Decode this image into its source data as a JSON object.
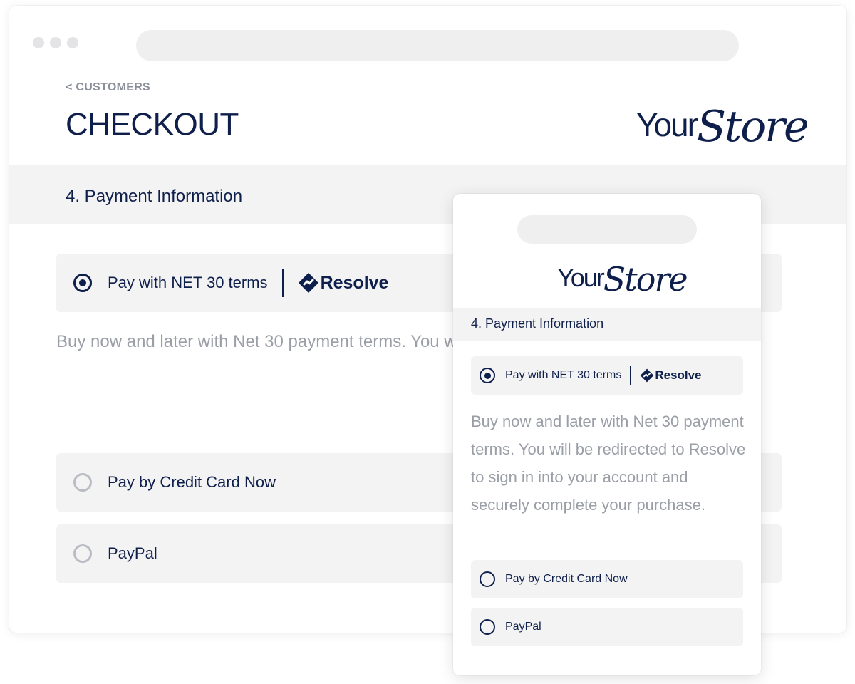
{
  "desktop": {
    "breadcrumb": "< CUSTOMERS",
    "title": "CHECKOUT",
    "logo": {
      "part1": "Your",
      "part2": "Store"
    },
    "section_title": "4.  Payment Information",
    "options": [
      {
        "label": "Pay with NET 30 terms",
        "selected": true,
        "partner": "Resolve"
      },
      {
        "label": "Pay by Credit Card Now",
        "selected": false
      },
      {
        "label": "PayPal",
        "selected": false
      }
    ],
    "description": "Buy now and later with Net 30 payment terms. You wi\nto sign in into your account and securely complete yo"
  },
  "mobile": {
    "logo": {
      "part1": "Your",
      "part2": "Store"
    },
    "section_title": "4.   Payment Information",
    "options": [
      {
        "label": "Pay with NET 30 terms",
        "selected": true,
        "partner": "Resolve"
      },
      {
        "label": "Pay by Credit Card Now",
        "selected": false
      },
      {
        "label": "PayPal",
        "selected": false
      }
    ],
    "description": "Buy now and later with Net 30 payment terms. You will be redirected to Resolve to sign in into your account and securely complete your purchase."
  },
  "colors": {
    "brand_navy": "#0f1f4b",
    "muted_text": "#9a9ea6",
    "panel_gray": "#f3f3f3"
  },
  "icons": {
    "resolve_logo": "resolve-diamond-icon",
    "radio": "radio-icon"
  }
}
